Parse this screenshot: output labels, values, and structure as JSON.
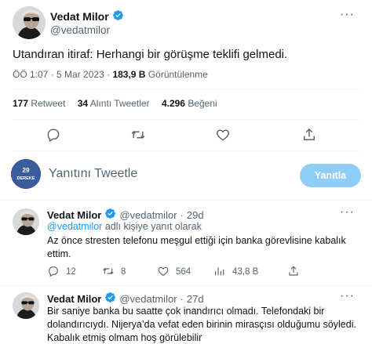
{
  "main_tweet": {
    "author_name": "Vedat Milor",
    "author_handle": "@vedatmilor",
    "text": "Utandıran itiraf: Herhangi bir görüşme teklifi gelmedi.",
    "time": "ÖÖ 1:07",
    "date": "5 Mar 2023",
    "views_count": "183,9 B",
    "views_label": "Görüntülenme",
    "retweets_count": "177",
    "retweets_label": "Retweet",
    "quotes_count": "34",
    "quotes_label": "Alıntı Tweetler",
    "likes_count": "4.296",
    "likes_label": "Beğeni"
  },
  "composer": {
    "avatar_text_top": "29",
    "avatar_text_bottom": "DEREKE",
    "placeholder": "Yanıtını Tweetle",
    "reply_button_label": "Yanıtla"
  },
  "replies": [
    {
      "author_name": "Vedat Milor",
      "author_handle": "@vedatmilor",
      "age": "29d",
      "replying_mention": "@vedatmilor",
      "replying_suffix": "adlı kişiye yanıt olarak",
      "text_line1": "Az önce stresten telefonu meşgul ettiği için banka görevlisine kabalık",
      "text_line2": "ettim.",
      "reply_count": "12",
      "retweet_count": "8",
      "like_count": "564",
      "view_count": "43,8 B"
    },
    {
      "author_name": "Vedat Milor",
      "author_handle": "@vedatmilor",
      "age": "27d",
      "text_line1": "Bir saniye banka bu saatte çok inandırıcı olmadı. Telefondaki bir",
      "text_line2": "dolandırıcıydı. Nijerya’da vefat eden birinin mirasçısı olduğumu söyledi.",
      "text_line3": "Kabalık etmiş olmam hoş görülebilir"
    }
  ],
  "colors": {
    "accent": "#1d9bf0",
    "reply_button_disabled": "#8ecdf8",
    "muted_text": "#536471",
    "divider": "#eff3f4"
  },
  "icons": [
    "verified-badge-icon",
    "more-icon",
    "reply-icon",
    "retweet-icon",
    "like-icon",
    "share-icon",
    "views-icon"
  ]
}
